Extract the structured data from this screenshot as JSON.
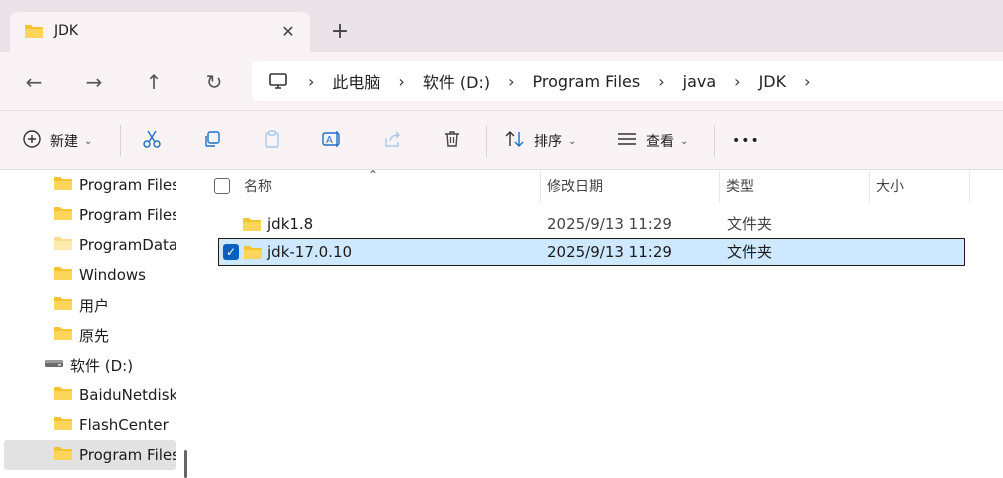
{
  "tab": {
    "title": "JDK",
    "close_glyph": "✕",
    "new_tab_glyph": "+"
  },
  "nav": {
    "back_glyph": "←",
    "forward_glyph": "→",
    "up_glyph": "↑",
    "refresh_glyph": "↻"
  },
  "breadcrumb": {
    "separator": "›",
    "items": [
      "此电脑",
      "软件 (D:)",
      "Program Files",
      "java",
      "JDK"
    ]
  },
  "toolbar": {
    "new_label": "新建",
    "sort_label": "排序",
    "view_label": "查看",
    "more_glyph": "•••",
    "caret": "⌄"
  },
  "navpane": {
    "items": [
      {
        "label": "Program Files"
      },
      {
        "label": "Program Files"
      },
      {
        "label": "ProgramData"
      },
      {
        "label": "Windows"
      },
      {
        "label": "用户"
      },
      {
        "label": "原先"
      },
      {
        "label": "软件 (D:)"
      },
      {
        "label": "BaiduNetdisk"
      },
      {
        "label": "FlashCenter"
      },
      {
        "label": "Program Files"
      }
    ]
  },
  "columns": {
    "name": "名称",
    "modified": "修改日期",
    "type": "类型",
    "size": "大小"
  },
  "files": [
    {
      "name": "jdk1.8",
      "modified": "2025/9/13 11:29",
      "type": "文件夹",
      "size": ""
    },
    {
      "name": "jdk-17.0.10",
      "modified": "2025/9/13 11:29",
      "type": "文件夹",
      "size": ""
    }
  ],
  "colors": {
    "accent": "#0a5fbf",
    "selection": "#cde8ff",
    "folder": "#f4c430"
  }
}
